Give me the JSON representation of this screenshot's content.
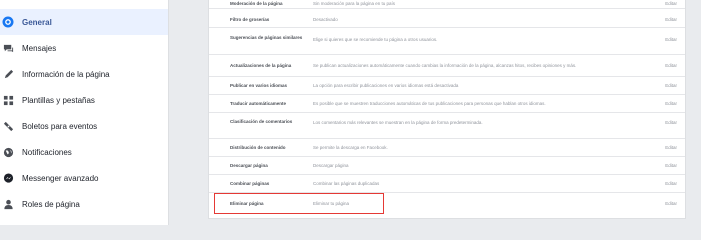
{
  "sidebar": {
    "items": [
      {
        "label": "General",
        "icon": "gear-icon",
        "active": true
      },
      {
        "label": "Mensajes",
        "icon": "chat-bubble-icon"
      },
      {
        "label": "Información de la página",
        "icon": "pencil-icon"
      },
      {
        "label": "Plantillas y pestañas",
        "icon": "grid-icon"
      },
      {
        "label": "Boletos para eventos",
        "icon": "ticket-icon"
      },
      {
        "label": "Notificaciones",
        "icon": "globe-icon"
      },
      {
        "label": "Messenger avanzado",
        "icon": "messenger-icon"
      },
      {
        "label": "Roles de página",
        "icon": "person-icon"
      }
    ]
  },
  "settings": {
    "edit_label": "Editar",
    "rows": [
      {
        "label": "Moderación de la página",
        "value": "Sin moderación para la página en tu país"
      },
      {
        "label": "Filtro de groserías",
        "value": "Desactivado"
      },
      {
        "label": "Sugerencias de páginas similares",
        "value": "Elige si quieres que se recomiende tu página a otros usuarios."
      },
      {
        "label": "Actualizaciones de la página",
        "value": "Se publican actualizaciones automáticamente cuando cambias la información de la página, alcanzas hitos, recibes opiniones y más."
      },
      {
        "label": "Publicar en varios idiomas",
        "value": "La opción para escribir publicaciones en varios idiomas está desactivada"
      },
      {
        "label": "Traducir automáticamente",
        "value": "Es posible que se muestren traducciones automáticas de tus publicaciones para personas que hablan otros idiomas."
      },
      {
        "label": "Clasificación de comentarios",
        "value": "Los comentarios más relevantes se muestran en la página de forma predeterminada."
      },
      {
        "label": "Distribución de contenido",
        "value": "Se permite la descarga en Facebook."
      },
      {
        "label": "Descargar página",
        "value": "Descargar página"
      },
      {
        "label": "Combinar páginas",
        "value": "Combinar las páginas duplicadas"
      },
      {
        "label": "Eliminar página",
        "value": "Eliminar tu página"
      }
    ]
  }
}
